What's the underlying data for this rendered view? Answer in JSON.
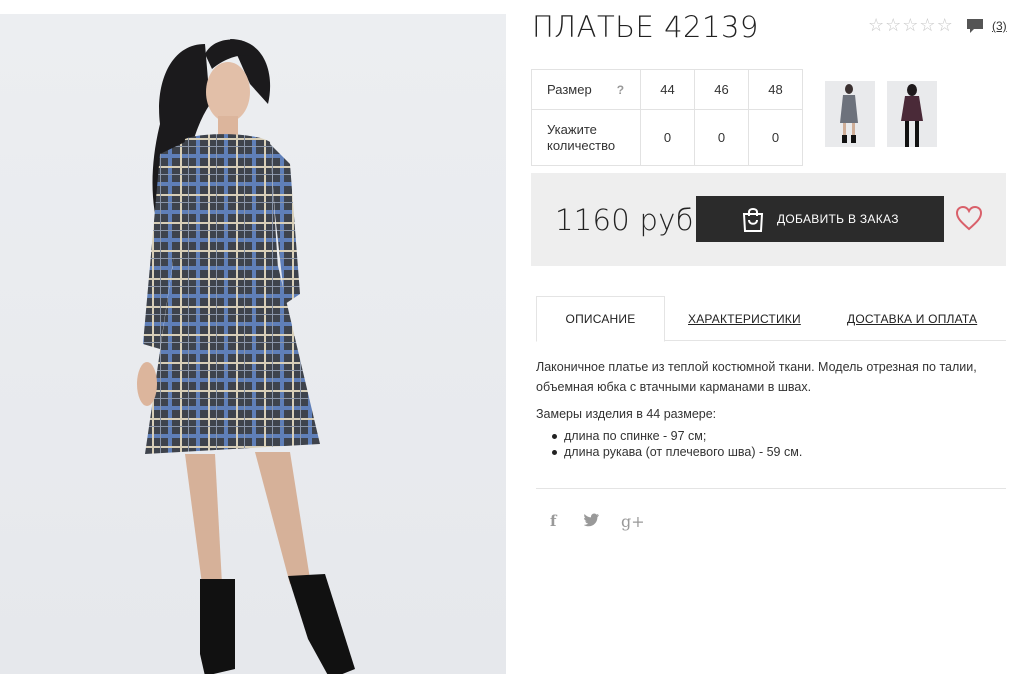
{
  "product": {
    "title": "ПЛАТЬЕ 42139",
    "review_count": "(3)",
    "rating_stars": 0,
    "price": "1160 руб",
    "add_button_label": "ДОБАВИТЬ В ЗАКАЗ"
  },
  "size_table": {
    "size_label": "Размер",
    "help_mark": "?",
    "qty_label": "Укажите количество",
    "sizes": [
      "44",
      "46",
      "48"
    ],
    "quantities": [
      "0",
      "0",
      "0"
    ]
  },
  "tabs": [
    {
      "label": "ОПИСАНИЕ",
      "active": true
    },
    {
      "label": "ХАРАКТЕРИСТИКИ",
      "active": false
    },
    {
      "label": "ДОСТАВКА И ОПЛАТА",
      "active": false
    }
  ],
  "description": {
    "text": "Лаконичное платье из теплой костюмной ткани. Модель отрезная по талии, объемная юбка с втачными карманами в швах.",
    "measure_title": "Замеры изделия в 44 размере:",
    "measures": [
      "длина по спинке - 97 см;",
      "длина рукава (от плечевого шва) - 59 см."
    ]
  },
  "social": {
    "facebook": "f",
    "twitter": "twitter-icon",
    "google": "g+"
  },
  "icons": {
    "star": "star-outline-icon",
    "comment": "comment-icon",
    "bag": "shopping-bag-icon",
    "heart": "heart-outline-icon"
  },
  "colors": {
    "button_bg": "#2b2b2b",
    "heart": "#d9606a",
    "buy_box_bg": "#eeeeee"
  }
}
